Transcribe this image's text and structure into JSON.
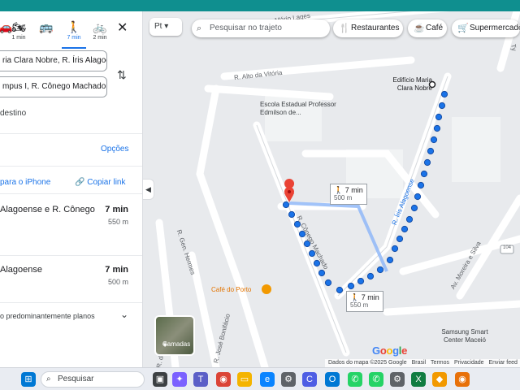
{
  "modes": [
    {
      "icon": "car-icon",
      "glyph": "🚗",
      "time": "",
      "active": false
    },
    {
      "icon": "motorcycle-icon",
      "glyph": "🏍",
      "time": "1 min",
      "active": false
    },
    {
      "icon": "transit-icon",
      "glyph": "🚌",
      "time": "",
      "active": false
    },
    {
      "icon": "walking-icon",
      "glyph": "🚶",
      "time": "7 min",
      "active": true
    },
    {
      "icon": "bicycle-icon",
      "glyph": "🚲",
      "time": "2 min",
      "active": false
    }
  ],
  "origin": "ria Clara Nobre, R. Íris Alagoense",
  "destination": "mpus I, R. Cônego Machado,",
  "add_destination": "destino",
  "options_label": "Opções",
  "send_label": "para o iPhone",
  "copy_label": "Copiar link",
  "routes": [
    {
      "name": "Alagoense e R. Cônego",
      "time": "7 min",
      "dist": "550 m"
    },
    {
      "name": "Alagoense",
      "time": "7 min",
      "dist": "500 m"
    }
  ],
  "terrain_note": "o predominantemente planos",
  "lang_chip": "Pt",
  "search_placeholder": "Pesquisar no trajeto",
  "chips": [
    {
      "icon": "restaurant-icon",
      "glyph": "🍴",
      "label": "Restaurantes"
    },
    {
      "icon": "cafe-icon",
      "glyph": "☕",
      "label": "Café"
    },
    {
      "icon": "cart-icon",
      "glyph": "🛒",
      "label": "Supermercado"
    }
  ],
  "map_labels": {
    "street_top": "Av. Cap. Mário Lages",
    "street_alto": "R. Alto da Vitória",
    "street_iris": "R. Íris Alagoense",
    "street_conego": "R. Cônego Machado",
    "street_hermes": "R. Gen. Hermes",
    "street_bonifacio": "R. José Bonifácio",
    "street_menezes": "R. de Menezes",
    "street_moreira": "Av. Moreira e Silva",
    "route_badge": "104",
    "street_ty": "Ty",
    "school": "Escola Estadual Professor Edmilson de...",
    "building": "Edifício Maria Clara Nobre",
    "cafe": "Café do Porto",
    "mall": "Samsung Smart Center Maceió"
  },
  "callouts": [
    {
      "time": "7 min",
      "dist": "500 m"
    },
    {
      "time": "7 min",
      "dist": "550 m"
    }
  ],
  "layers_label": "Camadas",
  "google_logo": "Google",
  "footer": [
    "Dados do mapa ©2025 Google",
    "Brasil",
    "Termos",
    "Privacidade",
    "Enviar feed"
  ],
  "taskbar_search": "Pesquisar",
  "colors": {
    "route": "#1a73e8",
    "accent": "#1a73e8",
    "pin": "#ea4335"
  }
}
